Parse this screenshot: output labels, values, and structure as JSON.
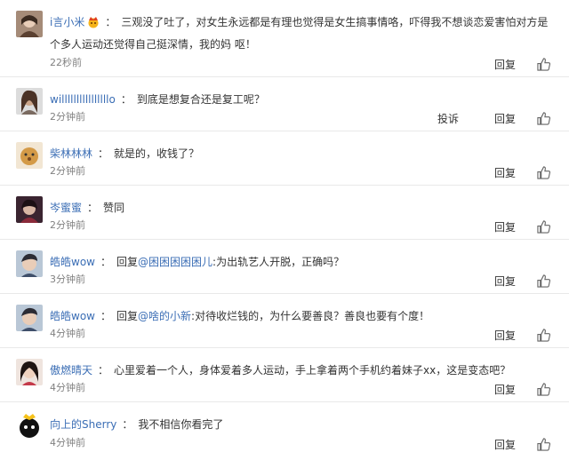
{
  "actions": {
    "reply": "回复",
    "report": "投诉"
  },
  "comments": [
    {
      "user": "i言小米",
      "colon": "：",
      "text": "三观没了吐了，对女生永远都是有理也觉得是女生搞事情咯，吓得我不想谈恋爱害怕对方是个多人运动还觉得自己挺深情，我的妈 呕！",
      "time": "22秒前"
    },
    {
      "user": "willllllllllllllllo",
      "colon": "：",
      "text": "到底是想复合还是复工呢？",
      "time": "2分钟前"
    },
    {
      "user": "柴林林林",
      "colon": "：",
      "text": "就是的，收钱了？",
      "time": "2分钟前"
    },
    {
      "user": "岑蜜蜜",
      "colon": "：",
      "text": "赞同",
      "time": "2分钟前"
    },
    {
      "user": "皓皓wow",
      "colon": "：",
      "reply_prefix": "回复",
      "reply_to": "@困困困困困儿",
      "text": ":为出轨艺人开脱，正确吗？",
      "time": "3分钟前"
    },
    {
      "user": "皓皓wow",
      "colon": "：",
      "reply_prefix": "回复",
      "reply_to": "@啥的小新",
      "text": ":对待收烂钱的，为什么要善良？善良也要有个度！",
      "time": "4分钟前"
    },
    {
      "user": "傲燃晴天",
      "colon": "：",
      "text": "心里爱着一个人，身体爱着多人运动，手上拿着两个手机约着妹子xx，这是变态吧？",
      "time": "4分钟前"
    },
    {
      "user": "向上的Sherry",
      "colon": "：",
      "text": "我不相信你看完了",
      "time": "4分钟前"
    }
  ]
}
